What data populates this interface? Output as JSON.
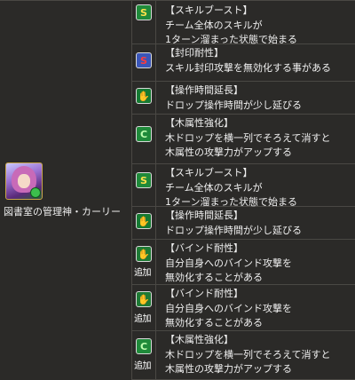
{
  "character": {
    "name": "図書室の管理神・カーリー"
  },
  "awakenings": [
    {
      "kind": "skill",
      "icon": "skill-boost-icon",
      "glyph": "S",
      "title": "【スキルブースト】",
      "lines": [
        "チーム全体のスキルが",
        "1ターン溜まった状態で始まる"
      ]
    },
    {
      "kind": "seal",
      "icon": "seal-resist-icon",
      "glyph": "S",
      "title": "【封印耐性】",
      "lines": [
        "スキル封印攻撃を無効化する事がある"
      ]
    },
    {
      "kind": "hand",
      "icon": "time-extend-icon",
      "glyph": "✋",
      "title": "【操作時間延長】",
      "lines": [
        "ドロップ操作時間が少し延びる"
      ]
    },
    {
      "kind": "wood",
      "icon": "wood-enhance-icon",
      "glyph": "C",
      "title": "【木属性強化】",
      "lines": [
        "木ドロップを横一列でそろえて消すと",
        "木属性の攻撃力がアップする"
      ]
    },
    {
      "kind": "skill",
      "icon": "skill-boost-icon",
      "glyph": "S",
      "title": "【スキルブースト】",
      "lines": [
        "チーム全体のスキルが",
        "1ターン溜まった状態で始まる"
      ]
    },
    {
      "kind": "hand",
      "icon": "time-extend-icon",
      "glyph": "✋",
      "title": "【操作時間延長】",
      "lines": [
        "ドロップ操作時間が少し延びる"
      ]
    },
    {
      "kind": "bind",
      "icon": "bind-resist-icon",
      "glyph": "✋",
      "tag": "追加",
      "title": "【バインド耐性】",
      "lines": [
        "自分自身へのバインド攻撃を",
        "無効化することがある"
      ]
    },
    {
      "kind": "bind",
      "icon": "bind-resist-icon",
      "glyph": "✋",
      "tag": "追加",
      "title": "【バインド耐性】",
      "lines": [
        "自分自身へのバインド攻撃を",
        "無効化することがある"
      ]
    },
    {
      "kind": "wood",
      "icon": "wood-enhance-icon",
      "glyph": "C",
      "tag": "追加",
      "title": "【木属性強化】",
      "lines": [
        "木ドロップを横一列でそろえて消すと",
        "木属性の攻撃力がアップする"
      ]
    }
  ]
}
